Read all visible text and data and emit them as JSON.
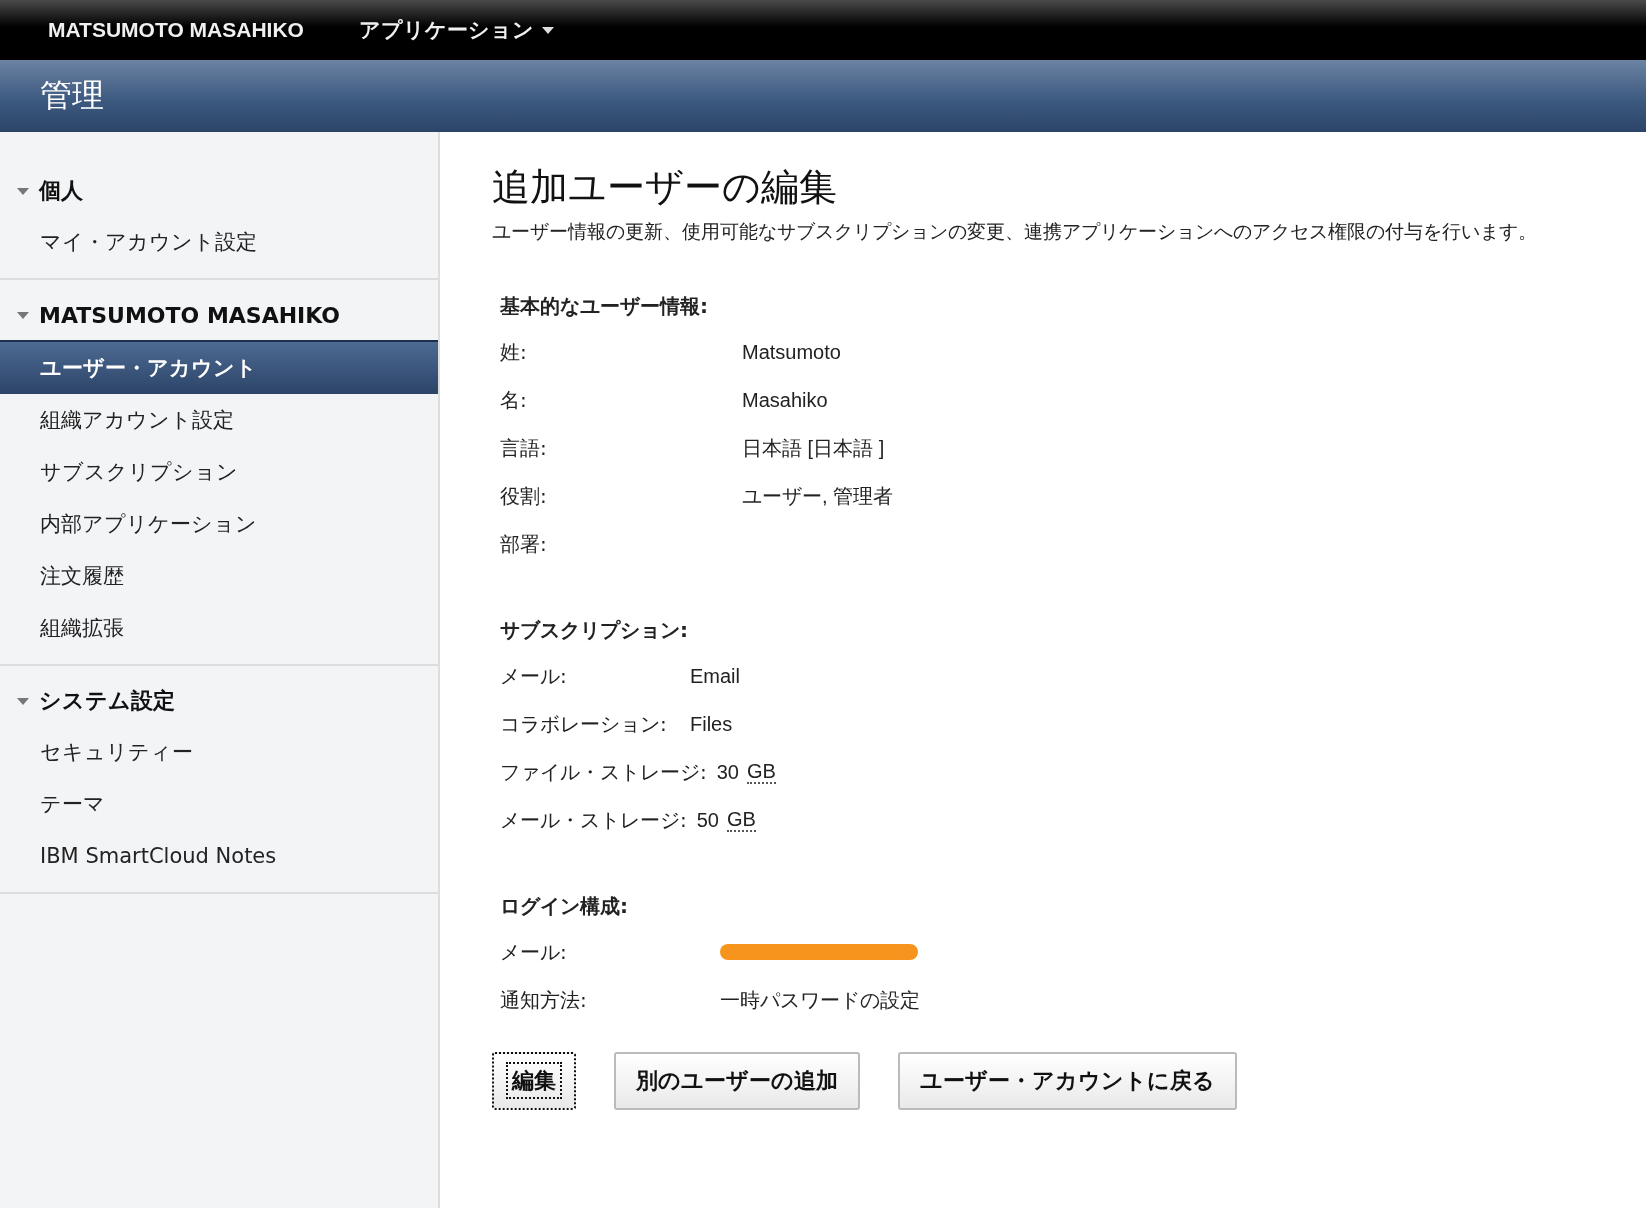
{
  "top_bar": {
    "user": "MATSUMOTO MASAHIKO",
    "menu": "アプリケーション"
  },
  "header": {
    "title": "管理"
  },
  "sidebar": {
    "sections": [
      {
        "title": "個人",
        "expanded": true,
        "items": [
          {
            "label": "マイ・アカウント設定",
            "selected": false
          }
        ]
      },
      {
        "title": "MATSUMOTO MASAHIKO",
        "expanded": true,
        "items": [
          {
            "label": "ユーザー・アカウント",
            "selected": true
          },
          {
            "label": "組織アカウント設定",
            "selected": false
          },
          {
            "label": "サブスクリプション",
            "selected": false
          },
          {
            "label": "内部アプリケーション",
            "selected": false
          },
          {
            "label": "注文履歴",
            "selected": false
          },
          {
            "label": "組織拡張",
            "selected": false
          }
        ]
      },
      {
        "title": "システム設定",
        "expanded": true,
        "items": [
          {
            "label": "セキュリティー",
            "selected": false
          },
          {
            "label": "テーマ",
            "selected": false
          },
          {
            "label": "IBM SmartCloud Notes",
            "selected": false
          }
        ]
      }
    ]
  },
  "main": {
    "title": "追加ユーザーの編集",
    "description": "ユーザー情報の更新、使用可能なサブスクリプションの変更、連携アプリケーションへのアクセス権限の付与を行います。",
    "sections": [
      {
        "heading": "基本的なユーザー情報:",
        "fields": [
          {
            "label": "姓:",
            "value": "Matsumoto"
          },
          {
            "label": "名:",
            "value": "Masahiko"
          },
          {
            "label": "言語:",
            "value": "日本語 [日本語 ]"
          },
          {
            "label": "役割:",
            "value": "ユーザー, 管理者"
          },
          {
            "label": "部署:"
          }
        ]
      },
      {
        "heading": "サブスクリプション:",
        "fields": [
          {
            "label": "メール:",
            "value": "Email"
          },
          {
            "label": "コラボレーション:",
            "value": "Files"
          },
          {
            "label": "ファイル・ストレージ:",
            "value": "30",
            "unit": "GB"
          },
          {
            "label": "メール・ストレージ:",
            "value": "50",
            "unit": "GB"
          }
        ]
      },
      {
        "heading": "ログイン構成:",
        "fields": [
          {
            "label": "メール:",
            "redacted": true
          },
          {
            "label": "通知方法:",
            "value": "一時パスワードの設定"
          }
        ]
      }
    ],
    "buttons": [
      {
        "label": "編集",
        "focused": true
      },
      {
        "label": "別のユーザーの追加",
        "focused": false
      },
      {
        "label": "ユーザー・アカウントに戻る",
        "focused": false
      }
    ]
  }
}
